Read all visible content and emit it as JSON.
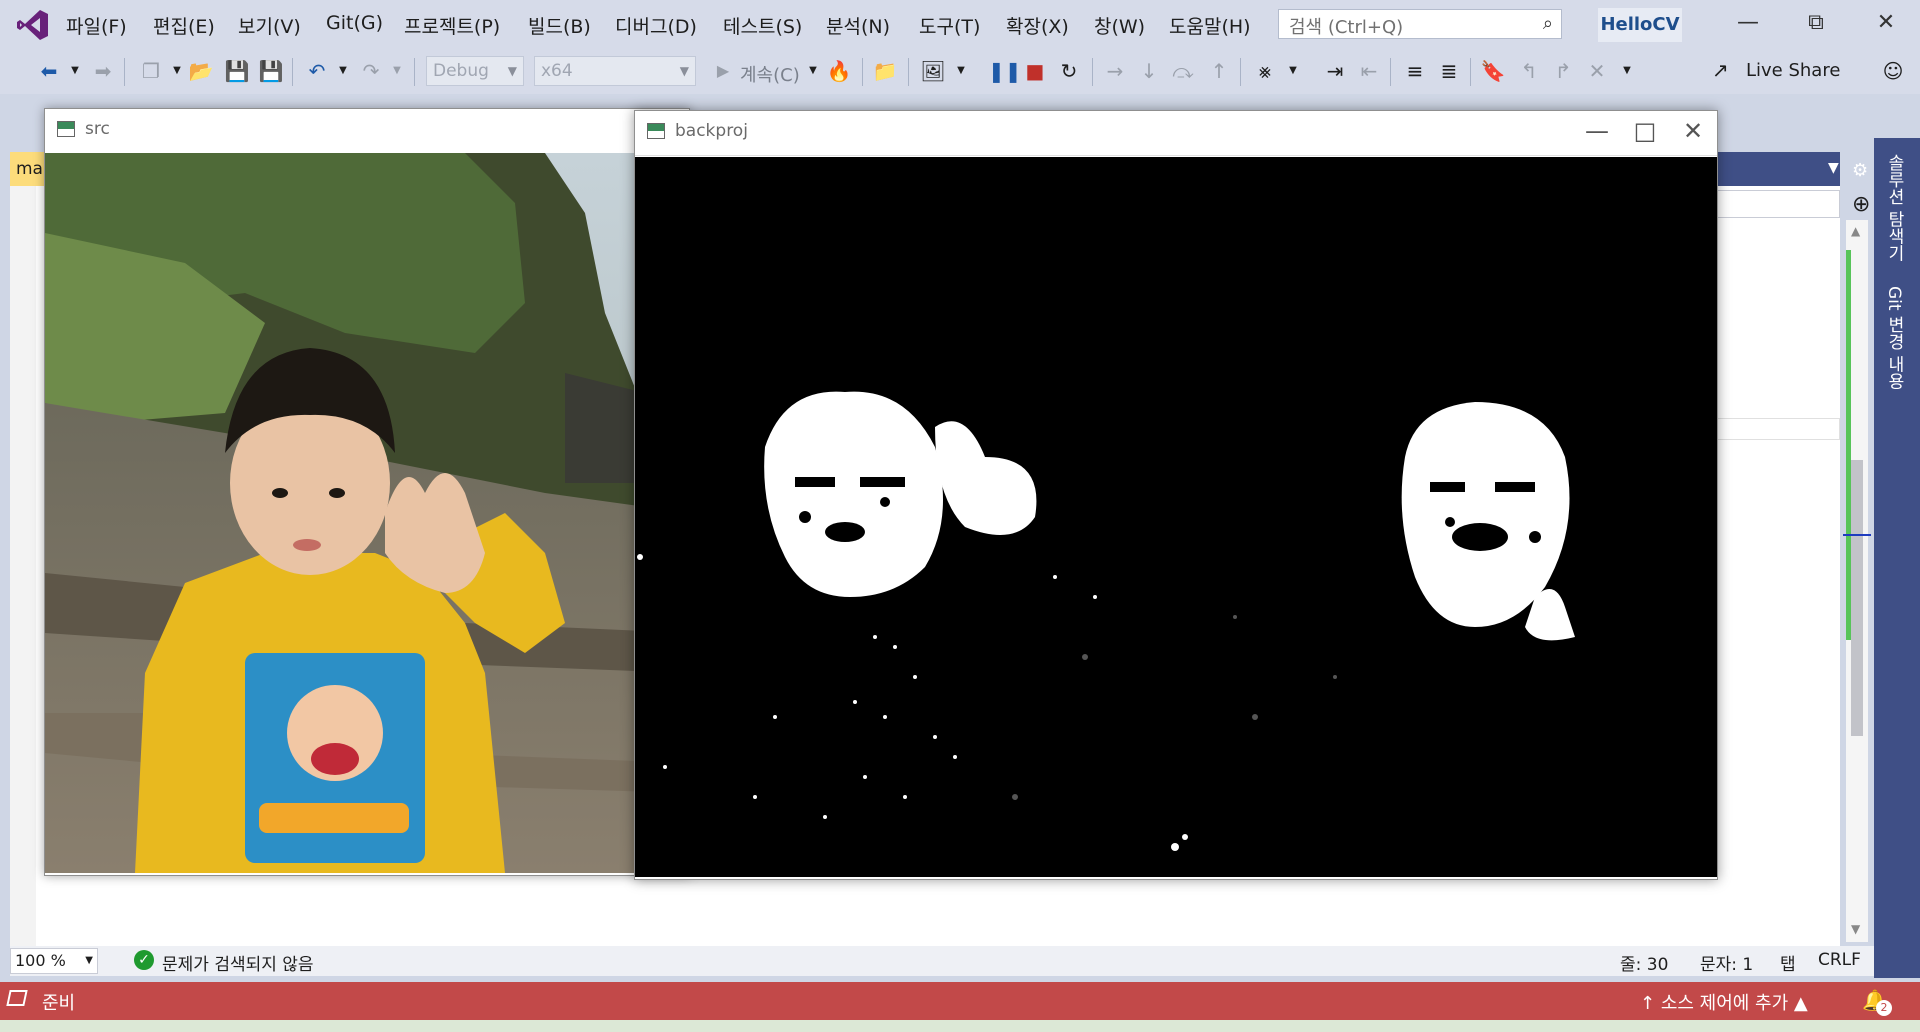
{
  "menu": {
    "items": [
      "파일(F)",
      "편집(E)",
      "보기(V)",
      "Git(G)",
      "프로젝트(P)",
      "빌드(B)",
      "디버그(D)",
      "테스트(S)",
      "분석(N)",
      "도구(T)",
      "확장(X)",
      "창(W)",
      "도움말(H)"
    ],
    "search_placeholder": "검색 (Ctrl+Q)",
    "solution_name": "HelloCV"
  },
  "toolbar": {
    "config": "Debug",
    "platform": "x64",
    "continue_label": "계속(C)",
    "live_share": "Live Share"
  },
  "editor": {
    "doc_tab_label": "mai"
  },
  "side_panel": {
    "solution_explorer": "솔루션 탐색기",
    "git_changes": "Git 변경 내용"
  },
  "windows": {
    "src_title": "src",
    "backproj_title": "backproj"
  },
  "editor_status": {
    "zoom": "100 %",
    "issues": "문제가 검색되지 않음",
    "line": "줄: 30",
    "char": "문자: 1",
    "tab": "탭",
    "eol": "CRLF"
  },
  "statusbar": {
    "ready": "준비",
    "source_control": "소스 제어에 추가",
    "notifications": "2"
  },
  "colors": {
    "accent": "#3f4f86",
    "status_bar": "#c24949",
    "brand": "#68217a"
  }
}
